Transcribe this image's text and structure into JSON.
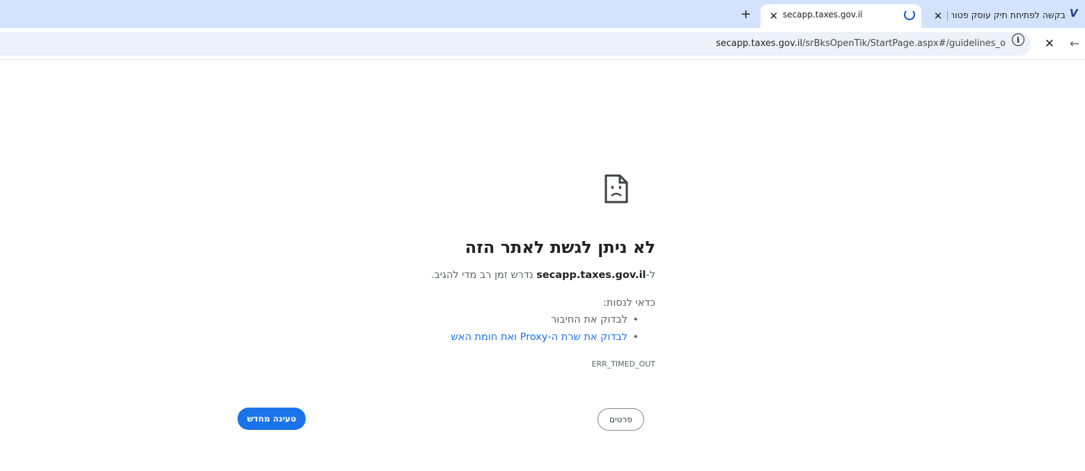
{
  "tabs": {
    "active": {
      "title": "secapp.taxes.gov.il",
      "close": "✕"
    },
    "inactive": {
      "title": "בקשה לפתיחת תיק עוסק פטור",
      "close": "✕",
      "favicon": "V"
    },
    "new_tab": "+"
  },
  "toolbar": {
    "url_host": "secapp.taxes.gov.il",
    "url_path": "/srBksOpenTik/StartPage.aspx#/guidelines_o",
    "info": "i",
    "stop": "✕",
    "back": "←"
  },
  "error": {
    "title": "לא ניתן לגשת לאתר הזה",
    "desc_prefix": "ל-",
    "desc_host": "secapp.taxes.gov.il",
    "desc_suffix": " נדרש זמן רב מדי להגיב.",
    "try_label": "כדאי לנסות:",
    "suggestions": {
      "check_connection": "לבדוק את החיבור",
      "check_proxy": "לבדוק את שרת ה-Proxy ואת חומת האש"
    },
    "code": "ERR_TIMED_OUT"
  },
  "buttons": {
    "details": "פרטים",
    "reload": "טעינה מחדש"
  },
  "colors": {
    "tabstrip": "#d3e3fd",
    "accent": "#1a73e8",
    "omnibox": "#edf2fa"
  },
  "icons": {
    "sad_page": "sad-page-icon",
    "spinner": "loading-spinner-icon"
  }
}
